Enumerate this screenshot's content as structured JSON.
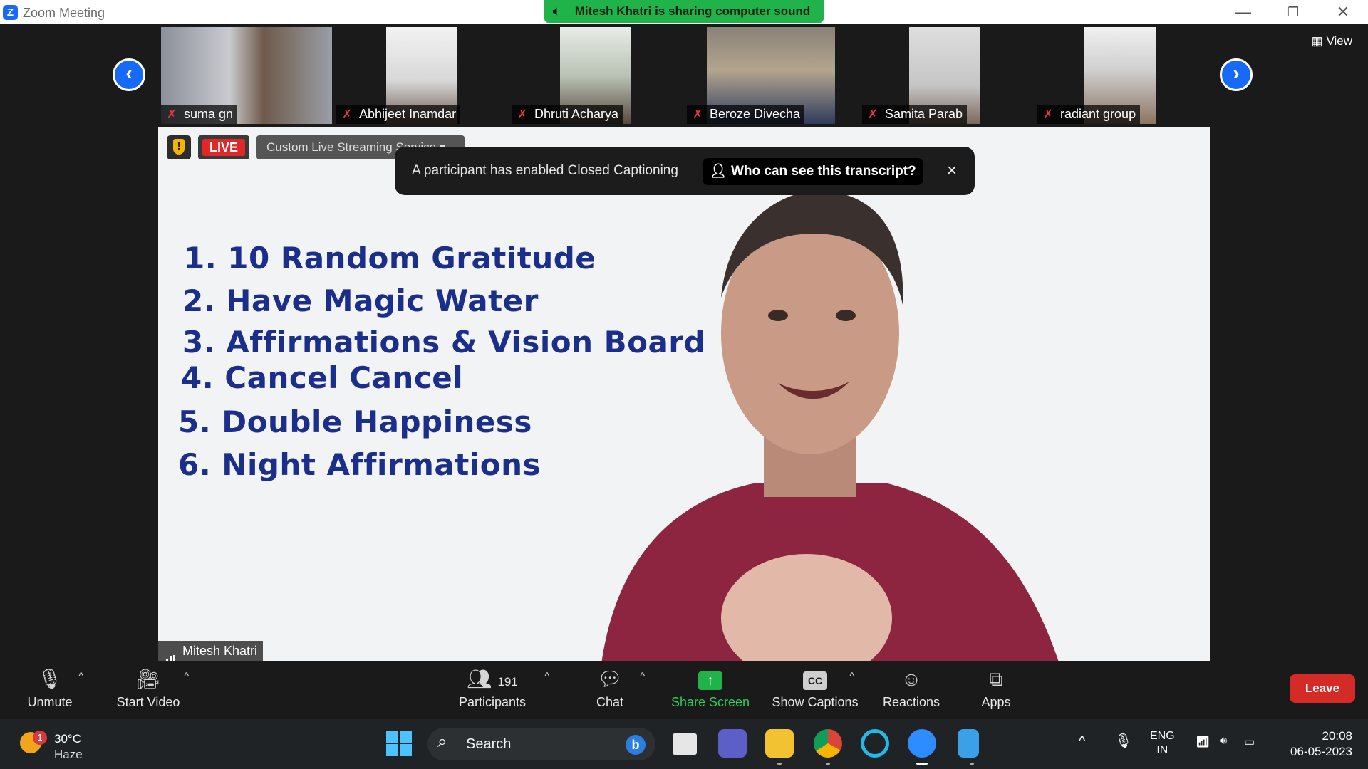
{
  "window": {
    "title": "Zoom Meeting",
    "app_icon": "zoom-logo-icon",
    "share_banner": "Mitesh Khatri is sharing computer sound",
    "view_label": "View"
  },
  "participants_strip": [
    {
      "name": "suma gn"
    },
    {
      "name": "Abhijeet Inamdar"
    },
    {
      "name": "Dhruti Acharya"
    },
    {
      "name": "Beroze Divecha"
    },
    {
      "name": "Samita Parab"
    },
    {
      "name": "radiant group"
    }
  ],
  "main_video": {
    "speaker": "Mitesh Khatri",
    "live_badge": "LIVE",
    "streaming_label": "Custom Live Streaming Service",
    "slide_items": [
      "1. 10 Random Gratitude",
      "2. Have Magic Water",
      "3. Affirmations & Vision Board",
      "4. Cancel Cancel",
      "5. Double Happiness",
      "6. Night Affirmations"
    ]
  },
  "toast": {
    "message": "A participant has enabled Closed Captioning",
    "button": "Who can see this transcript?",
    "close": "×"
  },
  "toolbar": {
    "unmute": "Unmute",
    "start_video": "Start Video",
    "participants_count": "191",
    "participants": "Participants",
    "chat": "Chat",
    "share_screen": "Share Screen",
    "show_captions": "Show Captions",
    "cc_icon_text": "CC",
    "reactions": "Reactions",
    "apps": "Apps",
    "leave": "Leave"
  },
  "taskbar": {
    "temperature": "30°C",
    "weather": "Haze",
    "weather_badge": "1",
    "search": "Search",
    "lang1": "ENG",
    "lang2": "IN",
    "time": "20:08",
    "date": "06-05-2023"
  },
  "colors": {
    "zoom_blue": "#1769f7",
    "share_green": "#20b34a",
    "leave_red": "#d52b27",
    "slide_text": "#1a2e8a"
  }
}
